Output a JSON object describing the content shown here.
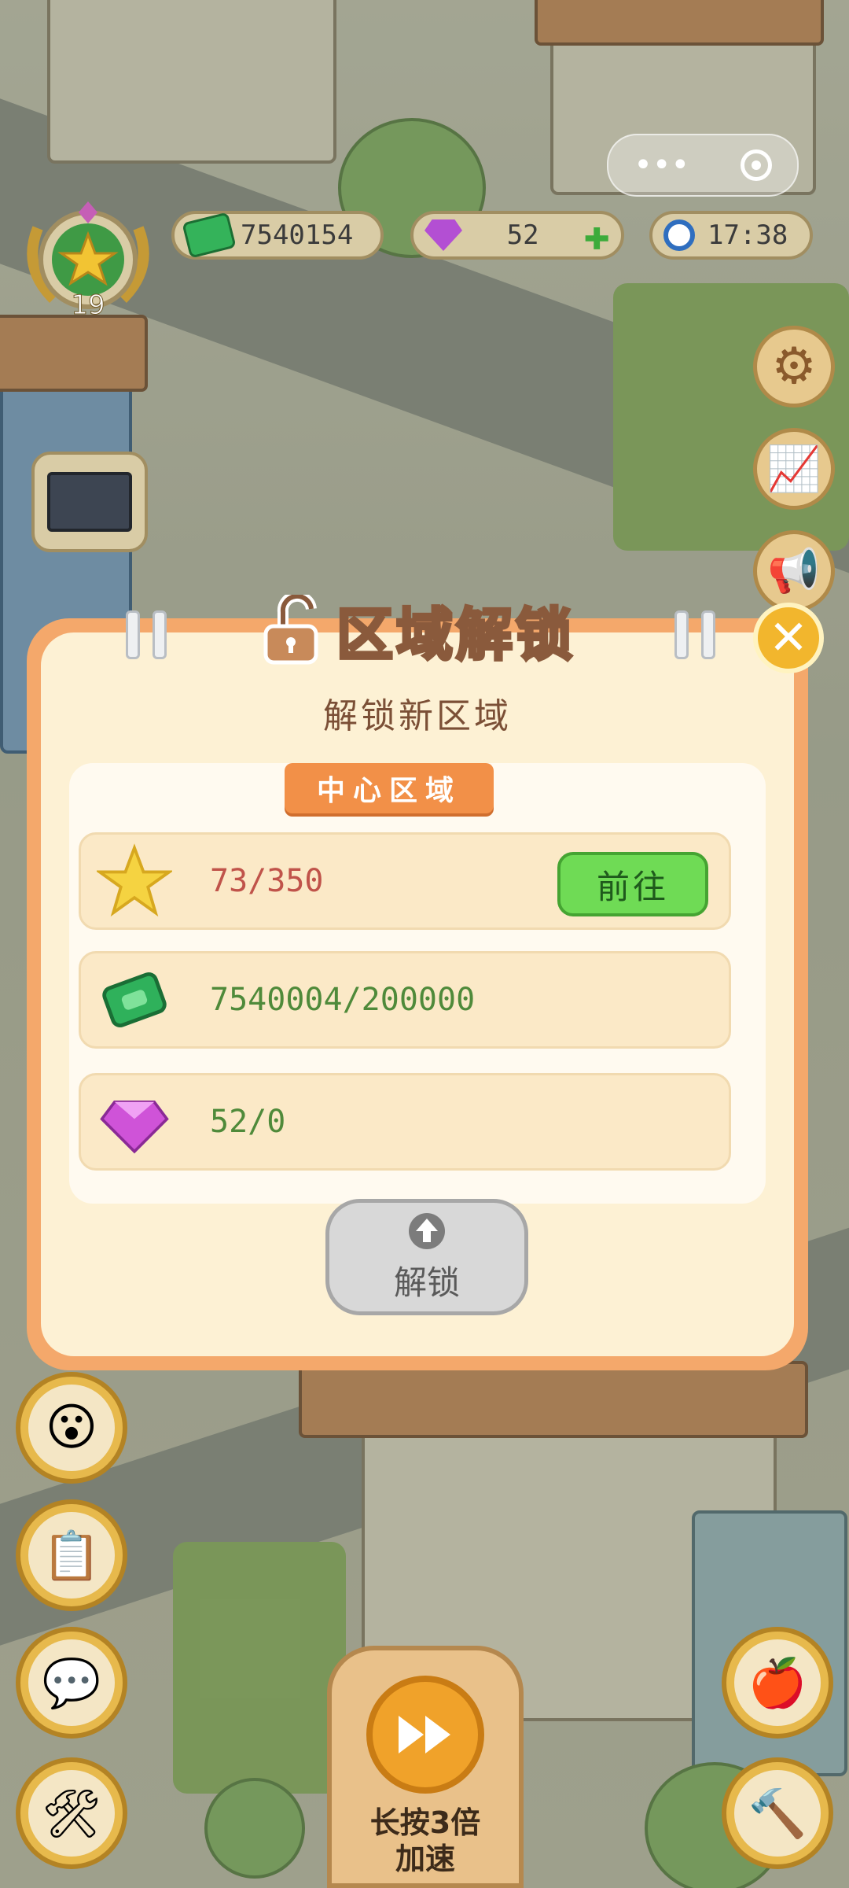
{
  "hud": {
    "level": "19",
    "cash": "7540154",
    "gems": "52",
    "time": "17:38"
  },
  "dialog": {
    "title": "区域解锁",
    "subtitle": "解锁新区域",
    "region_name": "中心区域",
    "requirements": [
      {
        "icon": "star-icon",
        "value": "73/350",
        "color": "#c0534a",
        "has_go": true
      },
      {
        "icon": "cash-icon",
        "value": "7540004/200000",
        "color": "#4f8a3a",
        "has_go": false
      },
      {
        "icon": "gem-icon",
        "value": "52/0",
        "color": "#4f8a3a",
        "has_go": false
      }
    ],
    "go_label": "前往",
    "unlock_label": "解锁",
    "close_label": "✕"
  },
  "speedup": {
    "label": "长按3倍\n加速"
  },
  "colors": {
    "dialog_border": "#f4a86b",
    "dialog_bg": "#fdf1d4",
    "region_tag": "#f29048",
    "go_button": "#6fdb55",
    "unlock_button": "#d8d8d8"
  }
}
